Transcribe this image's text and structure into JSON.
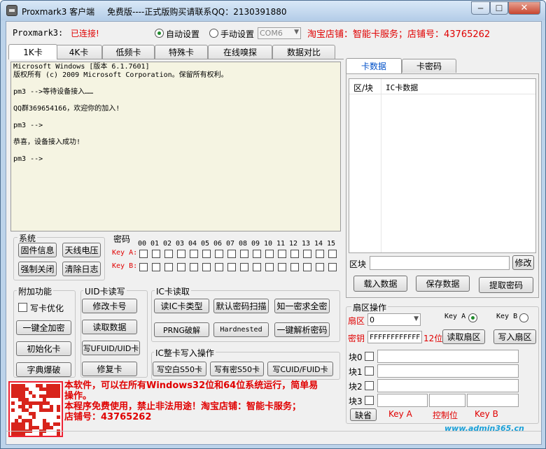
{
  "titlebar": {
    "app_title": "Proxmark3 客户端",
    "free_text": "免费版----正式版购买请联系QQ：2130391880",
    "minimize": "─",
    "maximize": "☐",
    "close": "✕"
  },
  "toolbar": {
    "device_label": "Proxmark3:",
    "device_status": "已连接!",
    "auto_label": "自动设置",
    "manual_label": "手动设置",
    "port_value": "COM6",
    "shop_text": "淘宝店铺：智能卡服务；店铺号：43765262"
  },
  "tabs": [
    "1K卡",
    "4K卡",
    "低频卡",
    "特殊卡",
    "在线嗅探",
    "数据对比"
  ],
  "console": {
    "text": "Microsoft Windows [版本 6.1.7601]\n版权所有 (c) 2009 Microsoft Corporation。保留所有权利。\n\npm3 -->等待设备接入……\n\nQQ群369654166，欢迎你的加入!\n\npm3 -->\n\n恭喜，设备接入成功!\n\npm3 -->"
  },
  "system": {
    "title": "系统",
    "buttons": [
      "固件信息",
      "天线电压",
      "强制关闭",
      "清除日志"
    ]
  },
  "password": {
    "title": "密码",
    "sector_numbers": [
      "00",
      "01",
      "02",
      "03",
      "04",
      "05",
      "06",
      "07",
      "08",
      "09",
      "10",
      "11",
      "12",
      "13",
      "14",
      "15"
    ],
    "key_a_label": "Key A:",
    "key_b_label": "Key B:"
  },
  "extras": {
    "title": "附加功能",
    "write_opt_label": "写卡优化",
    "buttons": [
      "一键全加密",
      "初始化卡",
      "字典爆破"
    ]
  },
  "uid": {
    "title": "UID卡读写",
    "buttons": [
      "修改卡号",
      "读取数据",
      "写UFUID/UID卡",
      "修复卡"
    ]
  },
  "ic_read": {
    "title": "IC卡读取",
    "buttons": [
      "读IC卡类型",
      "默认密码扫描",
      "知一密求全密",
      "PRNG破解",
      "Hardnested",
      "一键解析密码"
    ]
  },
  "ic_write": {
    "title": "IC整卡写入操作",
    "buttons": [
      "写空白S50卡",
      "写有密S50卡",
      "写CUID/FUID卡"
    ]
  },
  "notice": {
    "line1": "本软件，可以在所有Windows32位和64位系统运行，简单易",
    "line2": "操作。",
    "line3": "本程序免费使用，禁止非法用途！淘宝店铺：智能卡服务；",
    "line4": "店铺号：43765262"
  },
  "right_tabs": [
    "卡数据",
    "卡密码"
  ],
  "card_table": {
    "col1": "区/块",
    "col2": "IC卡数据"
  },
  "block_area": {
    "block_label": "区块",
    "modify_button": "修改",
    "buttons": [
      "载入数据",
      "保存数据",
      "提取密码"
    ]
  },
  "sector_ops": {
    "title": "扇区操作",
    "sector_label": "扇区",
    "sector_value": "0",
    "key_a_label": "Key A",
    "key_b_label": "Key B",
    "key_label": "密钥",
    "key_value": "FFFFFFFFFFFF",
    "key_len": "12位",
    "read_button": "读取扇区",
    "write_button": "写入扇区",
    "blocks": [
      "块0",
      "块1",
      "块2",
      "块3"
    ],
    "default_button": "缺省",
    "footer_key_a": "Key A",
    "footer_ctrl": "控制位",
    "footer_key_b": "Key B"
  },
  "watermark": "www.admin365.cn"
}
